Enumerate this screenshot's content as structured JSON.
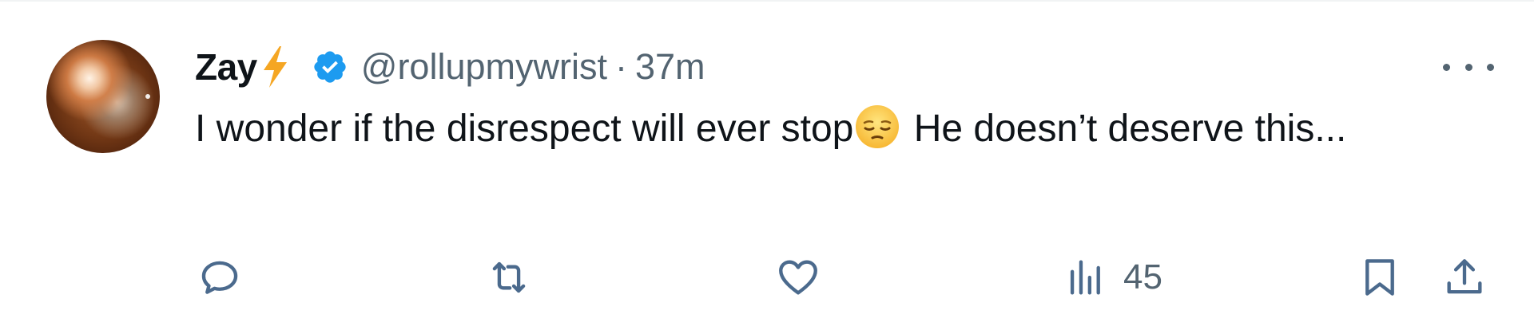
{
  "tweet": {
    "author_name": "Zay",
    "handle": "@rollupmywrist",
    "separator": "·",
    "time": "37m",
    "text_part1": "I wonder if the disrespect will ever stop",
    "text_part2": " He doesn’t deserve this...",
    "verified": true
  },
  "icons": {
    "name_emoji": "high-voltage-icon",
    "verified_badge": "verified-badge-icon",
    "body_emoji": "pensive-face-icon",
    "more": "more-options-icon",
    "reply": "reply-icon",
    "retweet": "retweet-icon",
    "like": "like-icon",
    "views": "views-icon",
    "bookmark": "bookmark-icon",
    "share": "share-icon"
  },
  "actions": {
    "views_count": "45"
  },
  "colors": {
    "text_primary": "#0f1419",
    "text_secondary": "#536471",
    "verified_blue": "#1d9bf0",
    "action_icon": "#4b6a8d",
    "lightning": "#f5a623"
  }
}
